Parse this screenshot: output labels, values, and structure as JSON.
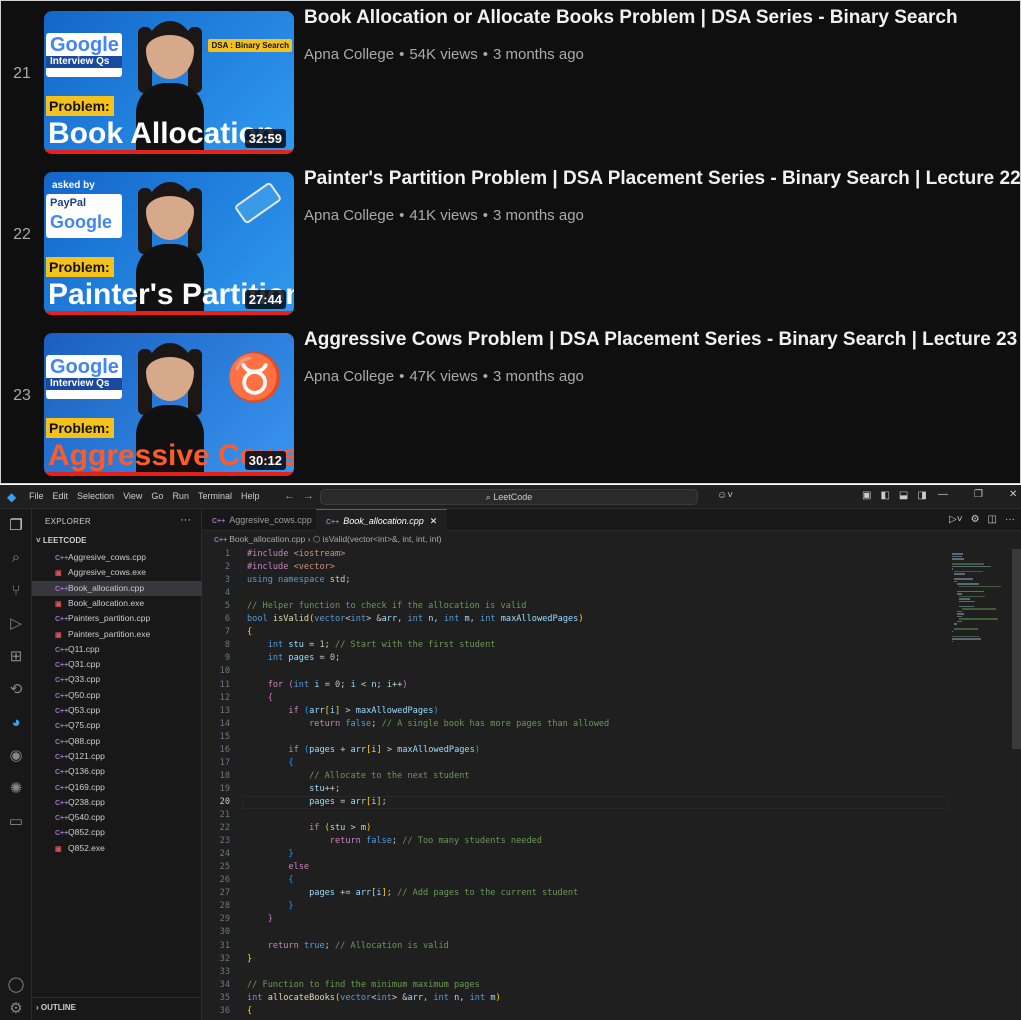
{
  "youtube": {
    "videos": [
      {
        "index": "21",
        "title": "Book Allocation or Allocate Books Problem | DSA Series - Binary Search",
        "channel": "Apna College",
        "views": "54K views",
        "age": "3 months ago",
        "duration": "32:59",
        "thumb_logo": "Google",
        "thumb_logo_sub": "Interview Qs",
        "thumb_problem": "Problem:",
        "thumb_big": "Book Allocation",
        "thumb_tag": "DSA : Binary Search"
      },
      {
        "index": "22",
        "title": "Painter's Partition Problem | DSA Placement Series - Binary Search | Lecture 22",
        "channel": "Apna College",
        "views": "41K views",
        "age": "3 months ago",
        "duration": "27:44",
        "thumb_asked": "asked by",
        "thumb_logo": "PayPal",
        "thumb_logo2": "Google",
        "thumb_problem": "Problem:",
        "thumb_big": "Painter's Partition"
      },
      {
        "index": "23",
        "title": "Aggressive Cows Problem | DSA Placement Series - Binary Search | Lecture 23",
        "channel": "Apna College",
        "views": "47K views",
        "age": "3 months ago",
        "duration": "30:12",
        "thumb_logo": "Google",
        "thumb_logo_sub": "Interview Qs",
        "thumb_problem": "Problem:",
        "thumb_big": "Aggressive Cows"
      }
    ],
    "separator": "•"
  },
  "vscode": {
    "menu": [
      "File",
      "Edit",
      "Selection",
      "View",
      "Go",
      "Run",
      "Terminal",
      "Help"
    ],
    "search": "LeetCode",
    "explorer_title": "EXPLORER",
    "folder": "LEETCODE",
    "files": [
      {
        "name": "Aggresive_cows.cpp",
        "type": "cpp"
      },
      {
        "name": "Aggresive_cows.exe",
        "type": "exe"
      },
      {
        "name": "Book_allocation.cpp",
        "type": "cpp",
        "selected": true
      },
      {
        "name": "Book_allocation.exe",
        "type": "exe"
      },
      {
        "name": "Painters_partition.cpp",
        "type": "cpp"
      },
      {
        "name": "Painters_partition.exe",
        "type": "exe"
      },
      {
        "name": "Q11.cpp",
        "type": "cpp"
      },
      {
        "name": "Q31.cpp",
        "type": "cpp"
      },
      {
        "name": "Q33.cpp",
        "type": "cpp"
      },
      {
        "name": "Q50.cpp",
        "type": "cpp"
      },
      {
        "name": "Q53.cpp",
        "type": "cpp"
      },
      {
        "name": "Q75.cpp",
        "type": "cpp"
      },
      {
        "name": "Q88.cpp",
        "type": "cpp"
      },
      {
        "name": "Q121.cpp",
        "type": "cpp"
      },
      {
        "name": "Q136.cpp",
        "type": "cpp"
      },
      {
        "name": "Q169.cpp",
        "type": "cpp"
      },
      {
        "name": "Q238.cpp",
        "type": "cpp"
      },
      {
        "name": "Q540.cpp",
        "type": "cpp"
      },
      {
        "name": "Q852.cpp",
        "type": "cpp"
      },
      {
        "name": "Q852.exe",
        "type": "exe"
      }
    ],
    "outline": "OUTLINE",
    "tabs": [
      {
        "name": "Aggresive_cows.cpp",
        "active": false
      },
      {
        "name": "Book_allocation.cpp",
        "active": true
      }
    ],
    "breadcrumb_file": "Book_allocation.cpp",
    "breadcrumb_symbol": "isValid(vector<int>&, int, int, int)",
    "cursor_line": 20,
    "code_lines": [
      [
        [
          "inc",
          "#include "
        ],
        [
          "st",
          "<iostream>"
        ]
      ],
      [
        [
          "inc",
          "#include "
        ],
        [
          "st",
          "<vector>"
        ]
      ],
      [
        [
          "kw",
          "using"
        ],
        [
          "",
          ""
        ],
        [
          "kw",
          " namespace"
        ],
        [
          "",
          " std;"
        ]
      ],
      [
        [
          "",
          ""
        ]
      ],
      [
        [
          "cm",
          "// Helper function to check if the allocation is valid"
        ]
      ],
      [
        [
          "ty",
          "bool"
        ],
        [
          "",
          " "
        ],
        [
          "fn",
          "isValid"
        ],
        [
          "br1",
          "("
        ],
        [
          "ty",
          "vector"
        ],
        [
          "",
          "<"
        ],
        [
          "ty",
          "int"
        ],
        [
          "",
          "> &"
        ],
        [
          "pr",
          "arr"
        ],
        [
          "",
          ", "
        ],
        [
          "ty",
          "int"
        ],
        [
          "",
          " "
        ],
        [
          "pr",
          "n"
        ],
        [
          "",
          ", "
        ],
        [
          "ty",
          "int"
        ],
        [
          "",
          " "
        ],
        [
          "pr",
          "m"
        ],
        [
          "",
          ", "
        ],
        [
          "ty",
          "int"
        ],
        [
          "",
          " "
        ],
        [
          "pr",
          "maxAllowedPages"
        ],
        [
          "br1",
          ")"
        ]
      ],
      [
        [
          "br1",
          "{"
        ]
      ],
      [
        [
          "",
          "    "
        ],
        [
          "ty",
          "int"
        ],
        [
          "",
          " "
        ],
        [
          "pr",
          "stu"
        ],
        [
          "",
          " = "
        ],
        [
          "nu",
          "1"
        ],
        [
          "",
          "; "
        ],
        [
          "cm",
          "// Start with the first student"
        ]
      ],
      [
        [
          "",
          "    "
        ],
        [
          "ty",
          "int"
        ],
        [
          "",
          " "
        ],
        [
          "pr",
          "pages"
        ],
        [
          "",
          " = "
        ],
        [
          "nu",
          "0"
        ],
        [
          "",
          ";"
        ]
      ],
      [
        [
          "",
          ""
        ]
      ],
      [
        [
          "",
          "    "
        ],
        [
          "ct",
          "for"
        ],
        [
          "",
          " "
        ],
        [
          "br2",
          "("
        ],
        [
          "ty",
          "int"
        ],
        [
          "",
          " "
        ],
        [
          "pr",
          "i"
        ],
        [
          "",
          " = "
        ],
        [
          "nu",
          "0"
        ],
        [
          "",
          "; "
        ],
        [
          "pr",
          "i"
        ],
        [
          "",
          " < "
        ],
        [
          "pr",
          "n"
        ],
        [
          "",
          "; "
        ],
        [
          "pr",
          "i"
        ],
        [
          "",
          "++"
        ],
        [
          "br2",
          ")"
        ]
      ],
      [
        [
          "",
          "    "
        ],
        [
          "br2",
          "{"
        ]
      ],
      [
        [
          "",
          "        "
        ],
        [
          "ct",
          "if"
        ],
        [
          "",
          " "
        ],
        [
          "br3",
          "("
        ],
        [
          "pr",
          "arr"
        ],
        [
          "br1",
          "["
        ],
        [
          "pr",
          "i"
        ],
        [
          "br1",
          "]"
        ],
        [
          "",
          " > "
        ],
        [
          "pr",
          "maxAllowedPages"
        ],
        [
          "br3",
          ")"
        ]
      ],
      [
        [
          "",
          "            "
        ],
        [
          "ct",
          "return"
        ],
        [
          "",
          " "
        ],
        [
          "kw",
          "false"
        ],
        [
          "",
          "; "
        ],
        [
          "cm",
          "// A single book has more pages than allowed"
        ]
      ],
      [
        [
          "",
          ""
        ]
      ],
      [
        [
          "",
          "        "
        ],
        [
          "ct",
          "if"
        ],
        [
          "",
          " "
        ],
        [
          "br3",
          "("
        ],
        [
          "pr",
          "pages"
        ],
        [
          "",
          " + "
        ],
        [
          "pr",
          "arr"
        ],
        [
          "br1",
          "["
        ],
        [
          "pr",
          "i"
        ],
        [
          "br1",
          "]"
        ],
        [
          "",
          " > "
        ],
        [
          "pr",
          "maxAllowedPages"
        ],
        [
          "br3",
          ")"
        ]
      ],
      [
        [
          "",
          "        "
        ],
        [
          "br3",
          "{"
        ]
      ],
      [
        [
          "",
          "            "
        ],
        [
          "cm",
          "// Allocate to the next student"
        ]
      ],
      [
        [
          "",
          "            "
        ],
        [
          "pr",
          "stu"
        ],
        [
          "",
          "++;"
        ]
      ],
      [
        [
          "",
          "            "
        ],
        [
          "pr",
          "pages"
        ],
        [
          "",
          " = "
        ],
        [
          "pr",
          "arr"
        ],
        [
          "br1",
          "["
        ],
        [
          "pr",
          "i"
        ],
        [
          "br1",
          "]"
        ],
        [
          "",
          ";"
        ]
      ],
      [
        [
          "",
          ""
        ]
      ],
      [
        [
          "",
          "            "
        ],
        [
          "ct",
          "if"
        ],
        [
          "",
          " "
        ],
        [
          "br1",
          "("
        ],
        [
          "pr",
          "stu"
        ],
        [
          "",
          " > "
        ],
        [
          "pr",
          "m"
        ],
        [
          "br1",
          ")"
        ]
      ],
      [
        [
          "",
          "                "
        ],
        [
          "ct",
          "return"
        ],
        [
          "",
          " "
        ],
        [
          "kw",
          "false"
        ],
        [
          "",
          "; "
        ],
        [
          "cm",
          "// Too many students needed"
        ]
      ],
      [
        [
          "",
          "        "
        ],
        [
          "br3",
          "}"
        ]
      ],
      [
        [
          "",
          "        "
        ],
        [
          "ct",
          "else"
        ]
      ],
      [
        [
          "",
          "        "
        ],
        [
          "br3",
          "{"
        ]
      ],
      [
        [
          "",
          "            "
        ],
        [
          "pr",
          "pages"
        ],
        [
          "",
          " += "
        ],
        [
          "pr",
          "arr"
        ],
        [
          "br1",
          "["
        ],
        [
          "pr",
          "i"
        ],
        [
          "br1",
          "]"
        ],
        [
          "",
          "; "
        ],
        [
          "cm",
          "// Add pages to the current student"
        ]
      ],
      [
        [
          "",
          "        "
        ],
        [
          "br3",
          "}"
        ]
      ],
      [
        [
          "",
          "    "
        ],
        [
          "br2",
          "}"
        ]
      ],
      [
        [
          "",
          ""
        ]
      ],
      [
        [
          "",
          "    "
        ],
        [
          "ct",
          "return"
        ],
        [
          "",
          " "
        ],
        [
          "kw",
          "true"
        ],
        [
          "",
          "; "
        ],
        [
          "cm",
          "// Allocation is valid"
        ]
      ],
      [
        [
          "br1",
          "}"
        ]
      ],
      [
        [
          "",
          ""
        ]
      ],
      [
        [
          "cm",
          "// Function to find the minimum maximum pages"
        ]
      ],
      [
        [
          "ty",
          "int"
        ],
        [
          "",
          " "
        ],
        [
          "fn",
          "allocateBooks"
        ],
        [
          "br1",
          "("
        ],
        [
          "ty",
          "vector"
        ],
        [
          "",
          "<"
        ],
        [
          "ty",
          "int"
        ],
        [
          "",
          "> &"
        ],
        [
          "pr",
          "arr"
        ],
        [
          "",
          ", "
        ],
        [
          "ty",
          "int"
        ],
        [
          "",
          " "
        ],
        [
          "pr",
          "n"
        ],
        [
          "",
          ", "
        ],
        [
          "ty",
          "int"
        ],
        [
          "",
          " "
        ],
        [
          "pr",
          "m"
        ],
        [
          "br1",
          ")"
        ]
      ],
      [
        [
          "br1",
          "{"
        ]
      ]
    ]
  }
}
